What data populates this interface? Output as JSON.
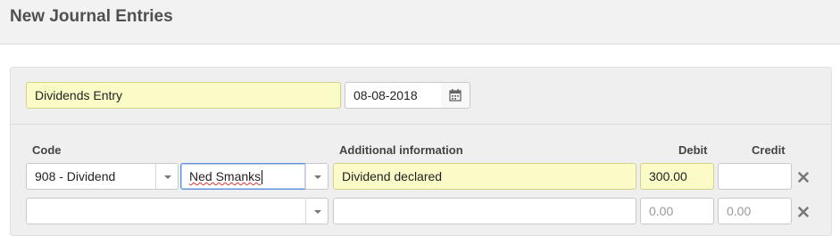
{
  "page": {
    "title": "New Journal Entries"
  },
  "entry": {
    "description": "Dividends Entry",
    "date": "08-08-2018"
  },
  "columns": {
    "code": "Code",
    "additional_info": "Additional information",
    "debit": "Debit",
    "credit": "Credit"
  },
  "rows": [
    {
      "code": "908 - Dividend",
      "contact": "Ned Smanks",
      "info": "Dividend declared",
      "debit": "300.00",
      "credit": ""
    },
    {
      "code": "",
      "contact": "",
      "info": "",
      "debit_placeholder": "0.00",
      "credit_placeholder": "0.00"
    }
  ],
  "icons": {
    "calendar": "calendar-icon",
    "dropdown": "chevron-down-icon",
    "remove": "close-icon"
  },
  "colors": {
    "highlight": "#fbfbc8",
    "focus_border": "#5b8fd6"
  }
}
